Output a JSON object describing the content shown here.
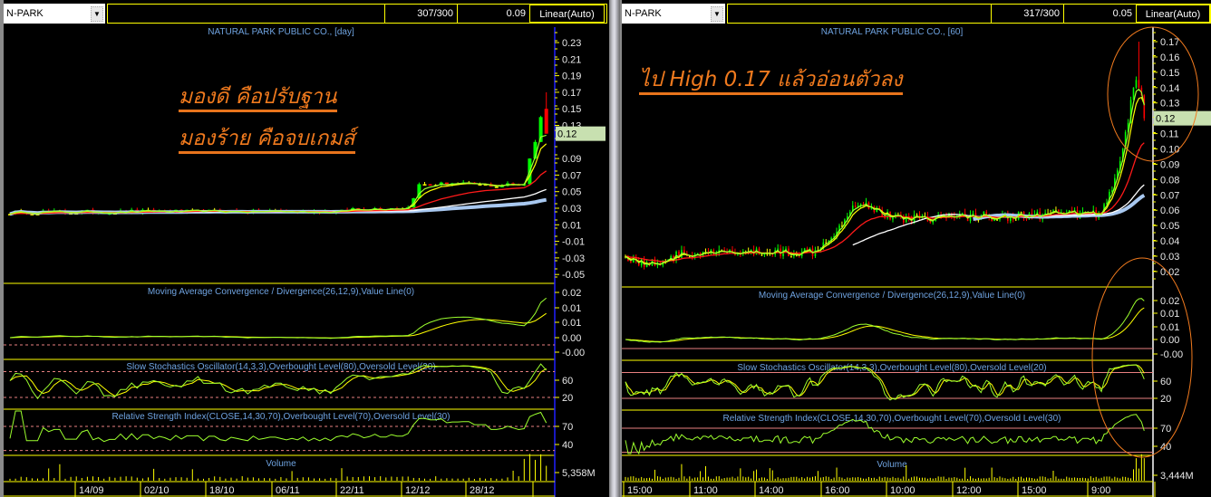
{
  "colors": {
    "background": "#000000",
    "grid_yellow": "#ffff00",
    "title_blue": "#6fa3e0",
    "axis_text": "#e8e8e8",
    "up_candle": "#00ff00",
    "down_candle": "#ff0000",
    "doji_candle": "#ffff00",
    "ma_fast": "#9cff2e",
    "ma_yellow": "#ffff00",
    "ma_red": "#ff1a1a",
    "ma_white": "#ffffff",
    "ma_lightblue": "#a8c8f0",
    "reference_line": "#e88080",
    "annotation_orange": "#f07a1e",
    "last_price_bg": "#c8e0b0"
  },
  "left": {
    "symbol": "N-PARK",
    "header": {
      "count": "307/300",
      "value": "0.09",
      "scale": "Linear(Auto)"
    },
    "title": "NATURAL PARK PUBLIC CO., [day]",
    "annotations": [
      "มองดี คือปรับฐาน",
      "มองร้าย คือจบเกมส์"
    ],
    "price_axis": [
      "0.23",
      "0.21",
      "0.19",
      "0.17",
      "0.15",
      "0.13",
      "0.09",
      "0.07",
      "0.05",
      "0.03",
      "0.01",
      "-0.01",
      "-0.03",
      "-0.05"
    ],
    "last_price": "0.12",
    "macd": {
      "title": "Moving Average Convergence / Divergence(26,12,9),Value Line(0)",
      "axis": [
        "0.02",
        "0.01",
        "0.01",
        "0.00",
        "-0.00"
      ]
    },
    "stoch": {
      "title": "Slow Stochastics Oscillator(14,3,3),Overbought Level(80),Oversold Level(20)",
      "axis": [
        "60",
        "20"
      ],
      "overbought": 80,
      "oversold": 20
    },
    "rsi": {
      "title": "Relative Strength Index(CLOSE,14,30,70),Overbought Level(70),Oversold Level(30)",
      "axis": [
        "70",
        "40"
      ],
      "overbought": 70,
      "oversold": 30
    },
    "volume": {
      "title": "Volume",
      "axis": "5,358M"
    },
    "dates": [
      "14/09",
      "02/10",
      "18/10",
      "06/11",
      "22/11",
      "12/12",
      "28/12"
    ],
    "price_path": [
      [
        0,
        0.025
      ],
      [
        30,
        0.026
      ],
      [
        60,
        0.026
      ],
      [
        62,
        0.029
      ],
      [
        72,
        0.031
      ],
      [
        74,
        0.058
      ],
      [
        80,
        0.06
      ],
      [
        88,
        0.057
      ],
      [
        93,
        0.06
      ],
      [
        94,
        0.09
      ],
      [
        95,
        0.11
      ],
      [
        96,
        0.14
      ],
      [
        97,
        0.12
      ]
    ],
    "last_candle": {
      "open": 0.15,
      "high": 0.17,
      "low": 0.12,
      "close": 0.12
    }
  },
  "right": {
    "symbol": "N-PARK",
    "header": {
      "count": "317/300",
      "value": "0.05",
      "scale": "Linear(Auto)"
    },
    "title": "NATURAL PARK PUBLIC CO., [60]",
    "annotations": [
      "ไป High 0.17 แล้วอ่อนตัวลง"
    ],
    "price_axis": [
      "0.17",
      "0.16",
      "0.15",
      "0.14",
      "0.13",
      "0.11",
      "0.10",
      "0.09",
      "0.08",
      "0.07",
      "0.06",
      "0.05",
      "0.04",
      "0.03",
      "0.02"
    ],
    "last_price": "0.12",
    "macd": {
      "title": "Moving Average Convergence / Divergence(26,12,9),Value Line(0)",
      "axis": [
        "0.02",
        "0.01",
        "0.01",
        "0.00",
        "-0.00"
      ]
    },
    "stoch": {
      "title": "Slow Stochastics Oscillator(14,3,3),Overbought Level(80),Oversold Level(20)",
      "axis": [
        "60",
        "20"
      ],
      "overbought": 80,
      "oversold": 20
    },
    "rsi": {
      "title": "Relative Strength Index(CLOSE,14,30,70),Overbought Level(70),Oversold Level(30)",
      "axis": [
        "70",
        "40"
      ],
      "overbought": 70,
      "oversold": 30
    },
    "volume": {
      "title": "Volume",
      "axis": "3,444M"
    },
    "dates": [
      "15:00",
      "11:00",
      "14:00",
      "16:00",
      "10:00",
      "12:00",
      "15:00",
      "9:00"
    ],
    "price_path": [
      [
        0,
        0.03
      ],
      [
        5,
        0.026
      ],
      [
        10,
        0.025
      ],
      [
        20,
        0.031
      ],
      [
        40,
        0.032
      ],
      [
        70,
        0.033
      ],
      [
        78,
        0.045
      ],
      [
        84,
        0.06
      ],
      [
        88,
        0.066
      ],
      [
        94,
        0.06
      ],
      [
        100,
        0.055
      ],
      [
        140,
        0.056
      ],
      [
        178,
        0.058
      ],
      [
        182,
        0.075
      ],
      [
        186,
        0.1
      ],
      [
        189,
        0.13
      ],
      [
        191,
        0.145
      ],
      [
        193,
        0.135
      ],
      [
        194,
        0.12
      ]
    ],
    "peak_high": 0.17
  }
}
